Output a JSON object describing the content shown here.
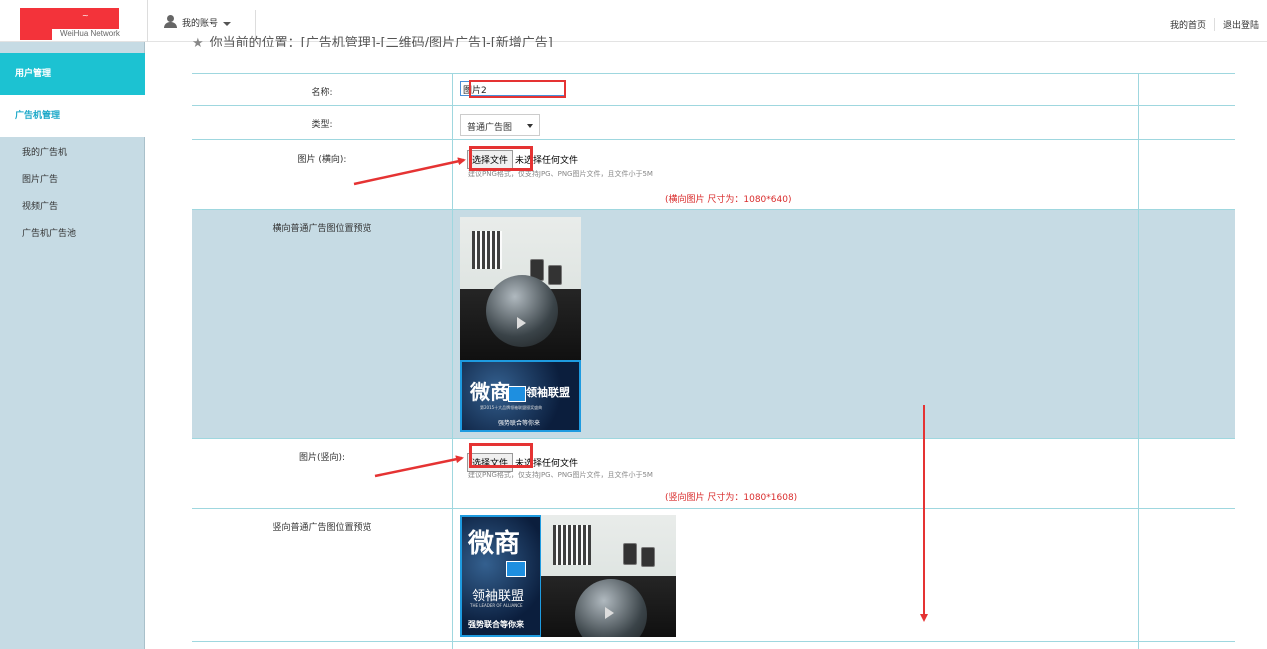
{
  "brand": {
    "logo_mark": "~",
    "logo_text": "WeiHua Network"
  },
  "topbar": {
    "account_label": "我的账号",
    "home_link": "我的首页",
    "logout_link": "退出登陆"
  },
  "sidebar": {
    "section_user": "用户管理",
    "section_ad_machine": "广告机管理",
    "items": [
      {
        "label": "我的广告机"
      },
      {
        "label": "图片广告"
      },
      {
        "label": "视频广告"
      },
      {
        "label": "广告机广告池"
      }
    ]
  },
  "breadcrumb": "你当前的位置：[广告机管理]-[二维码/图片广告]-[新增广告]",
  "form": {
    "name_label": "名称:",
    "name_value": "图片2",
    "type_label": "类型:",
    "type_value": "普通广告图",
    "image_h_label": "图片 (横向):",
    "file_button": "选择文件",
    "file_none": "未选择任何文件",
    "file_hint": "建议PNG格式，仅支持JPG、PNG图片文件，且文件小于5M",
    "size_note_h": "(横向图片 尺寸为：1080*640)",
    "preview_h_label": "横向普通广告图位置预览",
    "image_v_label": "图片(竖向):",
    "size_note_v": "(竖向图片 尺寸为：1080*1608)",
    "preview_v_label": "竖向普通广告图位置预览"
  },
  "preview": {
    "banner_title": "微商领袖联盟",
    "banner_title_short": "微商",
    "banner_title_rest": "领袖联盟",
    "banner_subtitle": "强势联合等你来",
    "banner_small": "第2015十大品牌领袖联盟颁奖盛典",
    "banner_en": "THE LEADER OF ALLIANCE"
  },
  "colors": {
    "accent_teal": "#1cc2d2",
    "sidebar_bg": "#c6dbe4",
    "annotation_red": "#e53333",
    "link_blue": "#1ca8c8"
  }
}
